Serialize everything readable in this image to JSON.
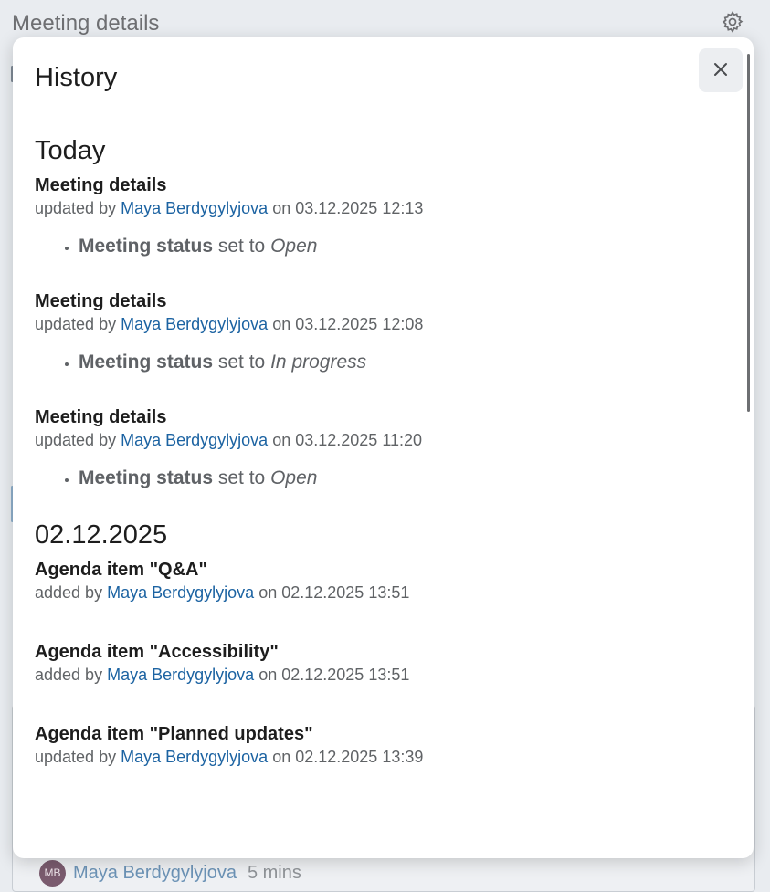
{
  "background": {
    "title": "Meeting details",
    "user": {
      "initials": "MB",
      "name": "Maya Berdygylyjova",
      "time": "5 mins"
    }
  },
  "modal": {
    "title": "History",
    "close_label": "×",
    "groups": [
      {
        "heading": "Today",
        "entries": [
          {
            "title": "Meeting details",
            "action": "updated by",
            "user": "Maya Berdygylyjova",
            "on": "on",
            "timestamp": "03.12.2025 12:13",
            "changes": [
              {
                "field": "Meeting status",
                "set_to": "set to",
                "value": "Open"
              }
            ]
          },
          {
            "title": "Meeting details",
            "action": "updated by",
            "user": "Maya Berdygylyjova",
            "on": "on",
            "timestamp": "03.12.2025 12:08",
            "changes": [
              {
                "field": "Meeting status",
                "set_to": "set to",
                "value": "In progress"
              }
            ]
          },
          {
            "title": "Meeting details",
            "action": "updated by",
            "user": "Maya Berdygylyjova",
            "on": "on",
            "timestamp": "03.12.2025 11:20",
            "changes": [
              {
                "field": "Meeting status",
                "set_to": "set to",
                "value": "Open"
              }
            ]
          }
        ]
      },
      {
        "heading": "02.12.2025",
        "entries": [
          {
            "title": "Agenda item \"Q&A\"",
            "action": "added by",
            "user": "Maya Berdygylyjova",
            "on": "on",
            "timestamp": "02.12.2025 13:51",
            "changes": []
          },
          {
            "title": "Agenda item \"Accessibility\"",
            "action": "added by",
            "user": "Maya Berdygylyjova",
            "on": "on",
            "timestamp": "02.12.2025 13:51",
            "changes": []
          },
          {
            "title": "Agenda item \"Planned updates\"",
            "action": "updated by",
            "user": "Maya Berdygylyjova",
            "on": "on",
            "timestamp": "02.12.2025 13:39",
            "changes": []
          }
        ]
      }
    ]
  },
  "icons": {
    "settings": "gear-icon",
    "close": "close-icon"
  },
  "colors": {
    "link": "#1c63a2",
    "backdrop": "#e9ecf0",
    "modal_bg": "#ffffff"
  }
}
